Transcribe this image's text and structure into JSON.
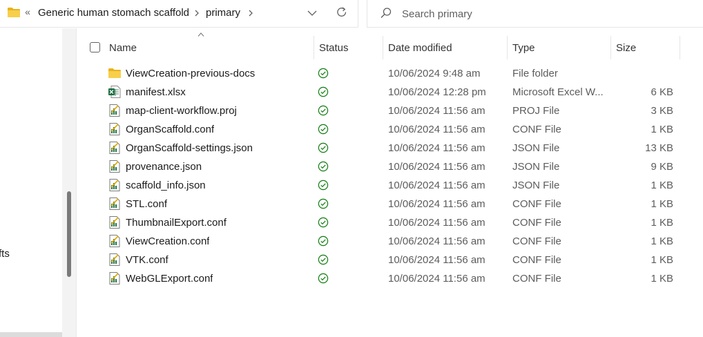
{
  "address": {
    "overflow": "«",
    "crumbs": [
      "Generic human stomach scaffold",
      "primary"
    ]
  },
  "search": {
    "placeholder": "Search primary"
  },
  "nav": {
    "partial_label": "fts"
  },
  "columns": {
    "name": "Name",
    "status": "Status",
    "date": "Date modified",
    "type": "Type",
    "size": "Size"
  },
  "files": [
    {
      "name": "ViewCreation-previous-docs",
      "icon": "folder-icon",
      "status": "synced",
      "date": "10/06/2024 9:48 am",
      "type": "File folder",
      "size": ""
    },
    {
      "name": "manifest.xlsx",
      "icon": "excel-file-icon",
      "status": "synced",
      "date": "10/06/2024 12:28 pm",
      "type": "Microsoft Excel W...",
      "size": "6 KB"
    },
    {
      "name": "map-client-workflow.proj",
      "icon": "text-file-icon",
      "status": "synced",
      "date": "10/06/2024 11:56 am",
      "type": "PROJ File",
      "size": "3 KB"
    },
    {
      "name": "OrganScaffold.conf",
      "icon": "text-file-icon",
      "status": "synced",
      "date": "10/06/2024 11:56 am",
      "type": "CONF File",
      "size": "1 KB"
    },
    {
      "name": "OrganScaffold-settings.json",
      "icon": "text-file-icon",
      "status": "synced",
      "date": "10/06/2024 11:56 am",
      "type": "JSON File",
      "size": "13 KB"
    },
    {
      "name": "provenance.json",
      "icon": "text-file-icon",
      "status": "synced",
      "date": "10/06/2024 11:56 am",
      "type": "JSON File",
      "size": "9 KB"
    },
    {
      "name": "scaffold_info.json",
      "icon": "text-file-icon",
      "status": "synced",
      "date": "10/06/2024 11:56 am",
      "type": "JSON File",
      "size": "1 KB"
    },
    {
      "name": "STL.conf",
      "icon": "text-file-icon",
      "status": "synced",
      "date": "10/06/2024 11:56 am",
      "type": "CONF File",
      "size": "1 KB"
    },
    {
      "name": "ThumbnailExport.conf",
      "icon": "text-file-icon",
      "status": "synced",
      "date": "10/06/2024 11:56 am",
      "type": "CONF File",
      "size": "1 KB"
    },
    {
      "name": "ViewCreation.conf",
      "icon": "text-file-icon",
      "status": "synced",
      "date": "10/06/2024 11:56 am",
      "type": "CONF File",
      "size": "1 KB"
    },
    {
      "name": "VTK.conf",
      "icon": "text-file-icon",
      "status": "synced",
      "date": "10/06/2024 11:56 am",
      "type": "CONF File",
      "size": "1 KB"
    },
    {
      "name": "WebGLExport.conf",
      "icon": "text-file-icon",
      "status": "synced",
      "date": "10/06/2024 11:56 am",
      "type": "CONF File",
      "size": "1 KB"
    }
  ],
  "colors": {
    "folder": "#f2c232",
    "status_green": "#107c10",
    "excel_green": "#1d6f42",
    "scrollbar": "#7a7a7a"
  }
}
